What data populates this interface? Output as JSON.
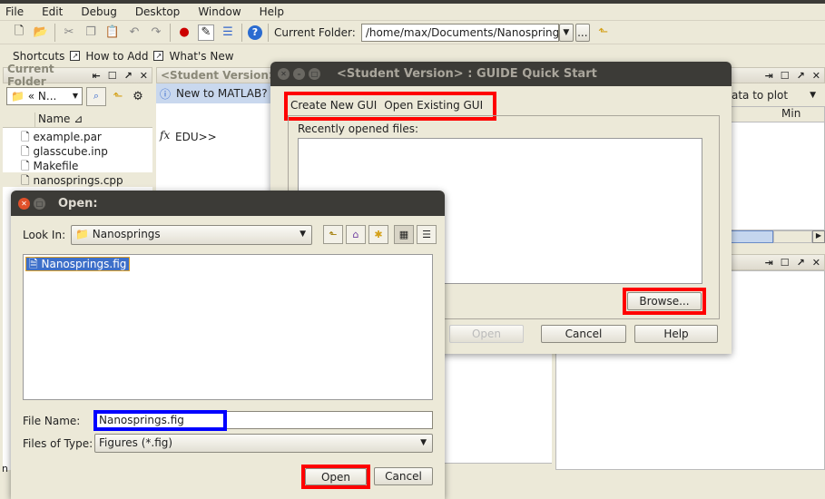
{
  "menu": [
    "File",
    "Edit",
    "Debug",
    "Desktop",
    "Window",
    "Help"
  ],
  "toolbar": {
    "current_folder_label": "Current Folder:",
    "current_folder_value": "/home/max/Documents/Nanosprings",
    "browse_label": "..."
  },
  "shortcuts": {
    "label": "Shortcuts",
    "items": [
      "How to Add",
      "What's New"
    ]
  },
  "current_folder_panel": {
    "title": "Current Folder",
    "path": "N...",
    "column_name": "Name",
    "files": [
      "example.par",
      "glasscube.inp",
      "Makefile",
      "nanosprings.cpp"
    ]
  },
  "command_window": {
    "title": "<Student Version>",
    "info": "New to MATLAB? W",
    "prompt": "EDU>>",
    "status": "n"
  },
  "workspace_panel": {
    "plot_dropdown": "ata to plot",
    "column_min": "Min"
  },
  "guide": {
    "title": "<Student Version> : GUIDE Quick Start",
    "tabs": [
      "Create New GUI",
      "Open Existing GUI"
    ],
    "recent_label": "Recently opened files:",
    "browse": "Browse...",
    "open": "Open",
    "cancel": "Cancel",
    "help": "Help"
  },
  "open_dialog": {
    "title": "Open:",
    "look_in_label": "Look In:",
    "look_in_value": "Nanosprings",
    "files": [
      "Nanosprings.fig"
    ],
    "file_name_label": "File Name:",
    "file_name_value": "Nanosprings.fig",
    "file_type_label": "Files of Type:",
    "file_type_value": "Figures (*.fig)",
    "open": "Open",
    "cancel": "Cancel"
  },
  "colors": {
    "highlight_red": "#ff0000",
    "highlight_blue": "#0000ff",
    "selection": "#3d6fc9"
  }
}
